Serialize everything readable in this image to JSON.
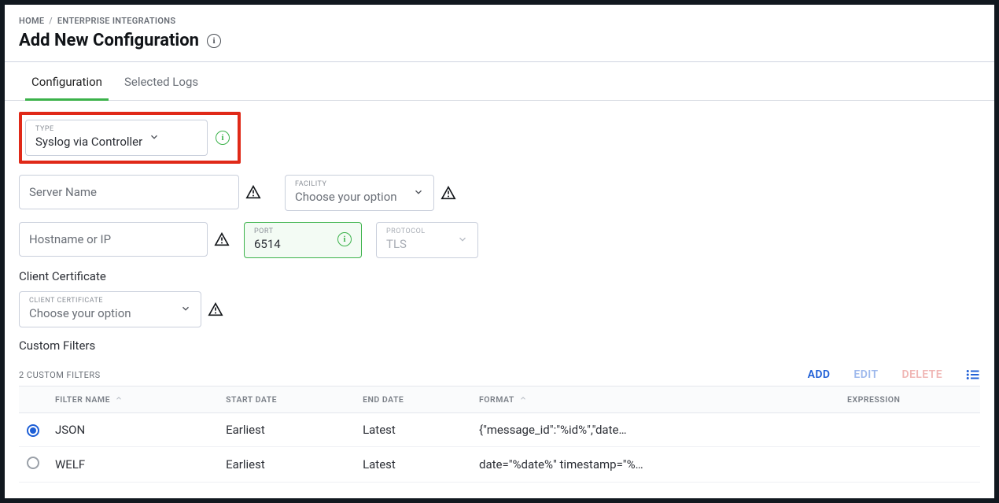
{
  "breadcrumb": {
    "home": "HOME",
    "section": "ENTERPRISE INTEGRATIONS"
  },
  "title": "Add New Configuration",
  "tabs": {
    "configuration": "Configuration",
    "selected_logs": "Selected Logs"
  },
  "fields": {
    "type": {
      "label": "TYPE",
      "value": "Syslog via Controller"
    },
    "server_name": {
      "placeholder": "Server Name"
    },
    "facility": {
      "label": "FACILITY",
      "placeholder": "Choose your option"
    },
    "hostname": {
      "placeholder": "Hostname or IP"
    },
    "port": {
      "label": "PORT",
      "value": "6514"
    },
    "protocol": {
      "label": "PROTOCOL",
      "value": "TLS"
    },
    "client_cert_heading": "Client Certificate",
    "client_cert": {
      "label": "CLIENT CERTIFICATE",
      "placeholder": "Choose your option"
    },
    "custom_filters_heading": "Custom Filters"
  },
  "filters": {
    "count_label": "2 CUSTOM FILTERS",
    "actions": {
      "add": "ADD",
      "edit": "EDIT",
      "delete": "DELETE"
    },
    "columns": {
      "filter_name": "FILTER NAME",
      "start_date": "START DATE",
      "end_date": "END DATE",
      "format": "FORMAT",
      "expression": "EXPRESSION"
    },
    "rows": [
      {
        "selected": true,
        "name": "JSON",
        "start": "Earliest",
        "end": "Latest",
        "format": "{\"message_id\":\"%id%\",\"date…",
        "expression": ""
      },
      {
        "selected": false,
        "name": "WELF",
        "start": "Earliest",
        "end": "Latest",
        "format": "date=\"%date%\" timestamp=\"%…",
        "expression": ""
      }
    ]
  }
}
